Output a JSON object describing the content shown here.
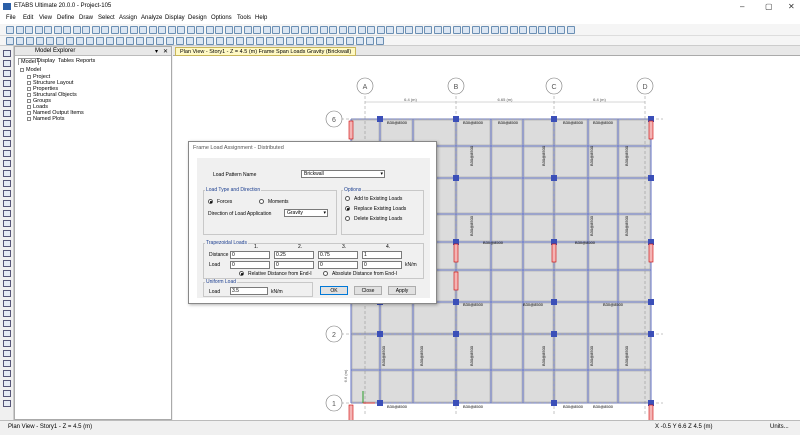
{
  "window": {
    "title": "ETABS Ultimate 20.0.0 - Project-105"
  },
  "menu": [
    "File",
    "Edit",
    "View",
    "Define",
    "Draw",
    "Select",
    "Assign",
    "Analyze",
    "Display",
    "Design",
    "Options",
    "Tools",
    "Help"
  ],
  "explorer": {
    "title": "Model Explorer",
    "tabs": [
      "Model",
      "Display",
      "Tables",
      "Reports"
    ],
    "root": "Model",
    "items": [
      "Project",
      "Structure Layout",
      "Properties",
      "Structural Objects",
      "Groups",
      "Loads",
      "Named Output Items",
      "Named Plots"
    ]
  },
  "view_tab": "Plan View - Story1 - Z = 4.5 (m)  Frame Span Loads Gravity (Brickwall)",
  "grid": {
    "columns": [
      "A",
      "B",
      "C",
      "D"
    ],
    "rows": [
      "6",
      "2",
      "1"
    ],
    "dims_top": [
      "6.4 (m)",
      "6.65 (m)",
      "6.4 (m)"
    ],
    "dim_left": "6.6 (m)"
  },
  "load_label": "B30@8500",
  "dialog": {
    "title": "Frame Load Assignment - Distributed",
    "load_pattern_label": "Load Pattern Name",
    "load_pattern_value": "Brickwall",
    "load_type_title": "Load Type and Direction",
    "forces_label": "Forces",
    "moments_label": "Moments",
    "direction_label": "Direction of Load Application",
    "direction_value": "Gravity",
    "options_title": "Options",
    "option_add": "Add to Existing Loads",
    "option_replace": "Replace Existing Loads",
    "option_delete": "Delete Existing Loads",
    "trap_title": "Trapezoidal Loads",
    "col_numbers": [
      "1.",
      "2.",
      "3.",
      "4."
    ],
    "distance_label": "Distance",
    "distance_values": [
      "0",
      "0.25",
      "0.75",
      "1"
    ],
    "load_label": "Load",
    "load_values": [
      "0",
      "0",
      "0",
      "0"
    ],
    "load_unit": "kN/m",
    "relative_label": "Relative Distance from End-I",
    "absolute_label": "Absolute Distance from End-I",
    "uniform_title": "Uniform Load",
    "uniform_load_label": "Load",
    "uniform_value": "3.5",
    "uniform_unit": "kN/m",
    "ok": "OK",
    "close": "Close",
    "apply": "Apply"
  },
  "status": {
    "left": "Plan View - Story1 - Z = 4.5 (m)",
    "coords": "X -0.5  Y 6.6  Z 4.5 (m)",
    "units": "Units..."
  }
}
